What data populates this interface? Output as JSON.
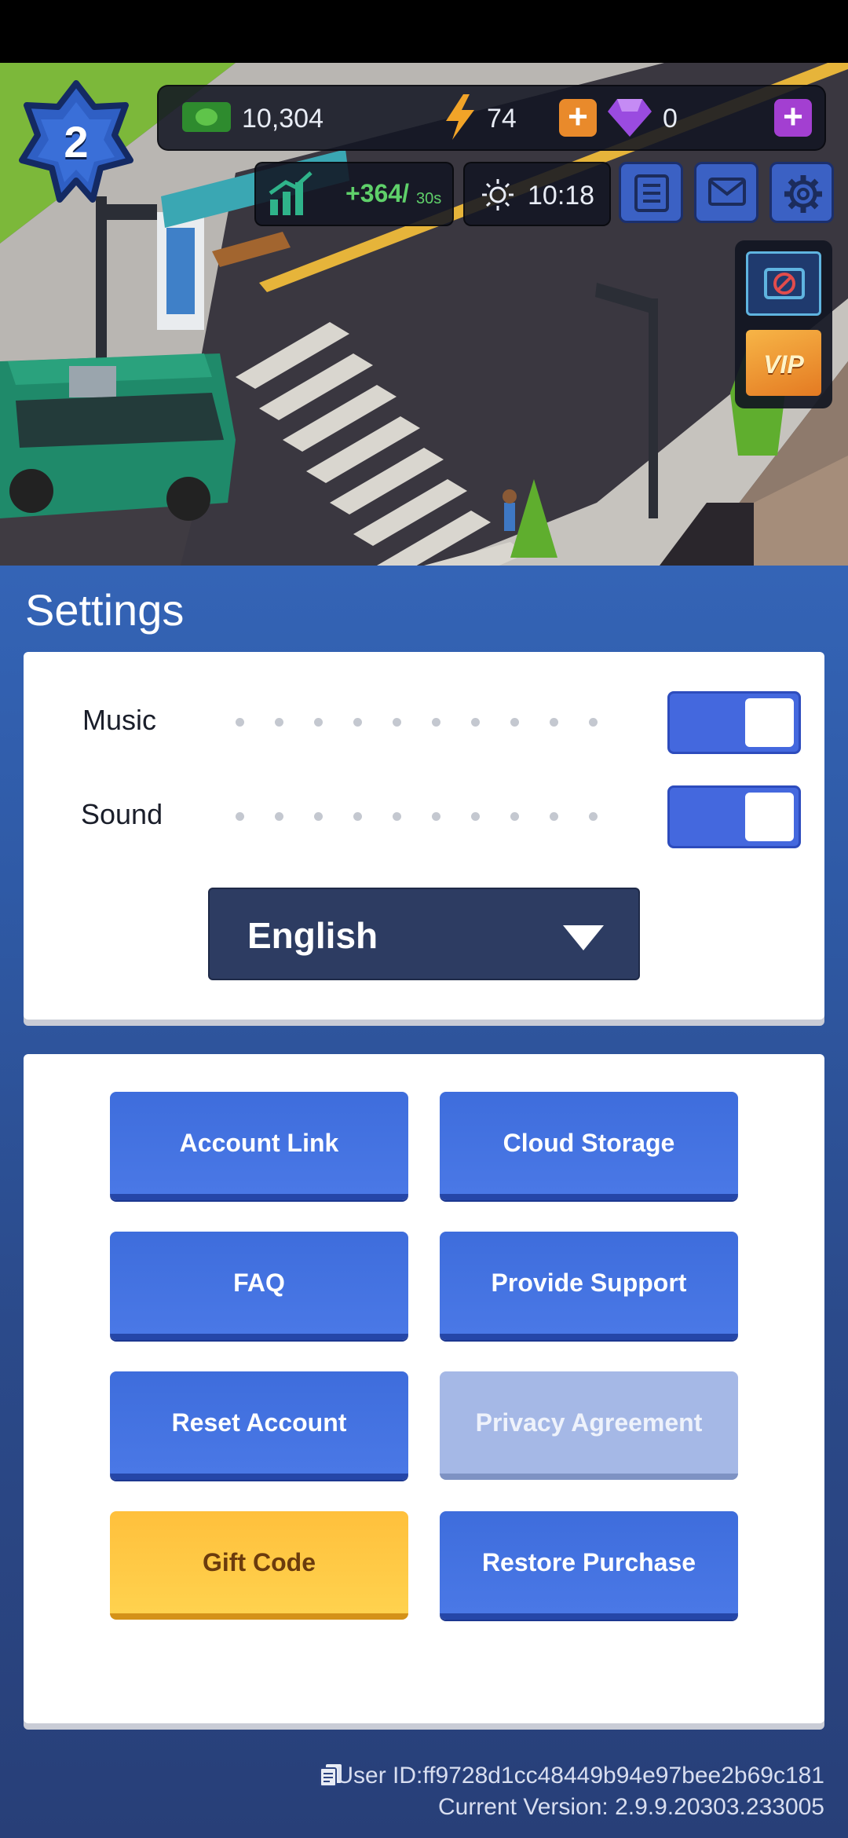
{
  "hud": {
    "level": "2",
    "cash": "10,304",
    "energy": "74",
    "gems": "0",
    "income": "+364/",
    "income_unit": "30s",
    "clock": "10:18",
    "side_panel": {
      "vip_label": "VIP"
    }
  },
  "settings": {
    "title": "Settings",
    "music_label": "Music",
    "sound_label": "Sound",
    "music_on": true,
    "sound_on": true,
    "language": "English"
  },
  "buttons": {
    "account_link": "Account Link",
    "cloud_storage": "Cloud Storage",
    "faq": "FAQ",
    "provide_support": "Provide Support",
    "reset_account": "Reset Account",
    "privacy_agreement": "Privacy Agreement",
    "gift_code": "Gift Code",
    "restore_purchase": "Restore Purchase"
  },
  "footer": {
    "user_id": "User ID:ff9728d1cc48449b94e97bee2b69c181",
    "version": "Current Version: 2.9.9.20303.233005"
  },
  "colors": {
    "primary_button": "#4468de",
    "gift_button": "#ffc83f",
    "panel_bg": "#2f5aa6",
    "disabled_button": "#a5b8e6"
  }
}
